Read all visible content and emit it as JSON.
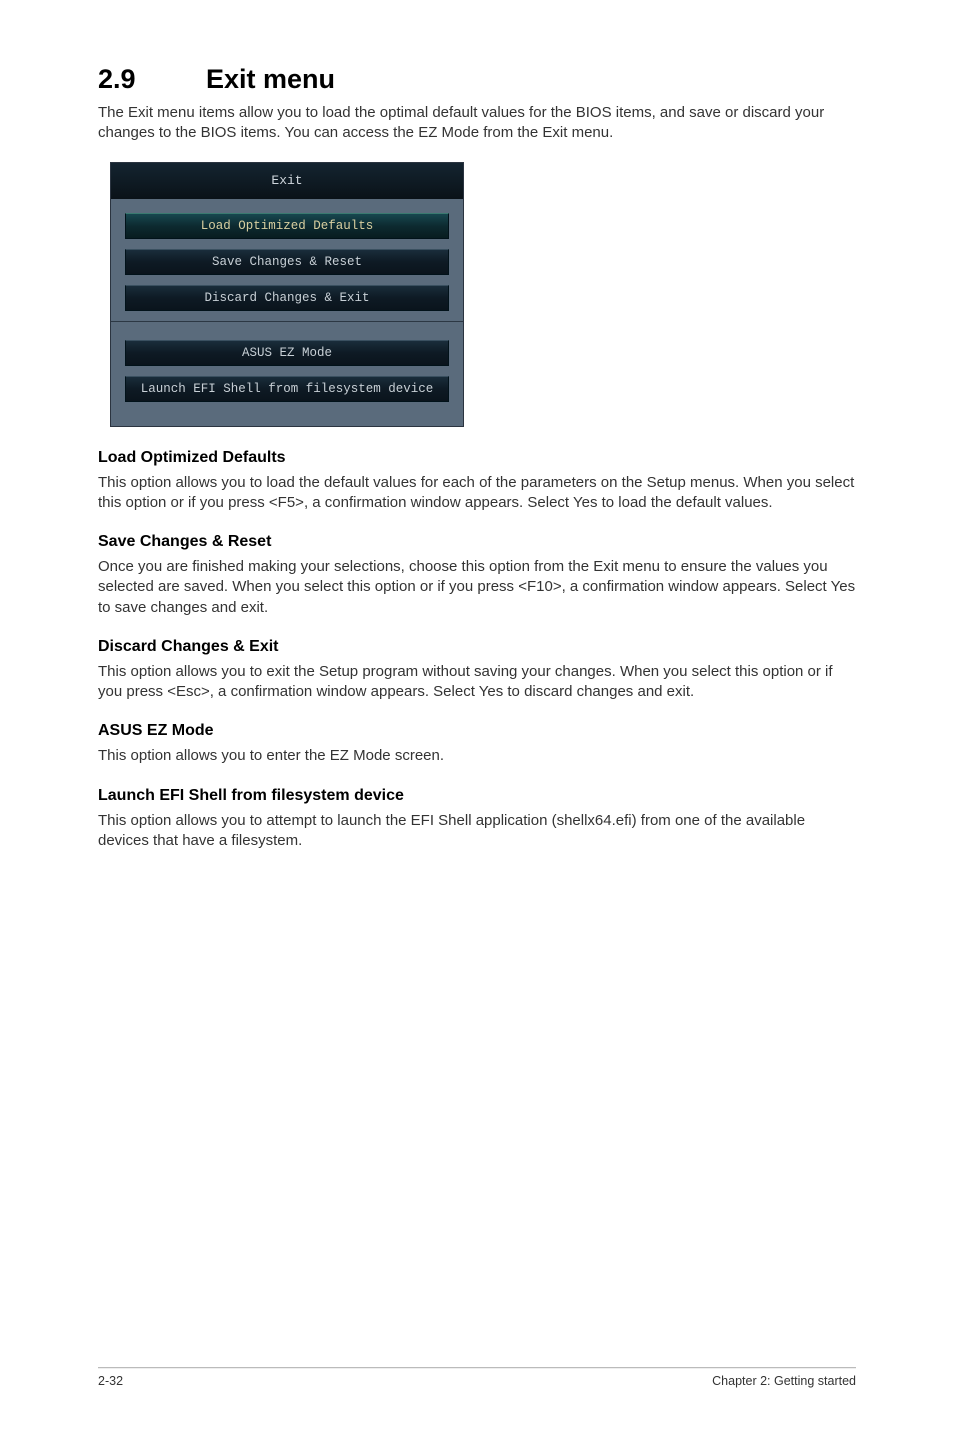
{
  "section": {
    "number": "2.9",
    "title": "Exit menu"
  },
  "intro": "The Exit menu items allow you to load the optimal default values for the BIOS items, and save or discard your changes to the BIOS items. You can access the EZ Mode from the Exit menu.",
  "bios": {
    "header": "Exit",
    "items1": [
      "Load Optimized Defaults",
      "Save Changes & Reset",
      "Discard Changes & Exit"
    ],
    "items2": [
      "ASUS EZ Mode",
      "Launch EFI Shell from filesystem device"
    ]
  },
  "sections": [
    {
      "heading": "Load Optimized Defaults",
      "body": "This option allows you to load the default values for each of the parameters on the Setup menus. When you select this option or if you press <F5>, a confirmation window appears. Select Yes to load the default values."
    },
    {
      "heading": "Save Changes & Reset",
      "body": "Once you are finished making your selections, choose this option from the Exit menu to ensure the values you selected are saved. When you select this option or if you press <F10>, a confirmation window appears. Select Yes to save changes and exit."
    },
    {
      "heading": "Discard Changes & Exit",
      "body": "This option allows you to exit the Setup program without saving your changes. When you select this option or if you press <Esc>, a confirmation window appears. Select Yes to discard changes and exit."
    },
    {
      "heading": "ASUS EZ Mode",
      "body": "This option allows you to enter the EZ Mode screen."
    },
    {
      "heading": "Launch EFI Shell from filesystem device",
      "body": "This option allows you to attempt to launch the EFI Shell application (shellx64.efi) from one of the available devices that have a filesystem."
    }
  ],
  "footer": {
    "page": "2-32",
    "chapter": "Chapter 2: Getting started"
  }
}
